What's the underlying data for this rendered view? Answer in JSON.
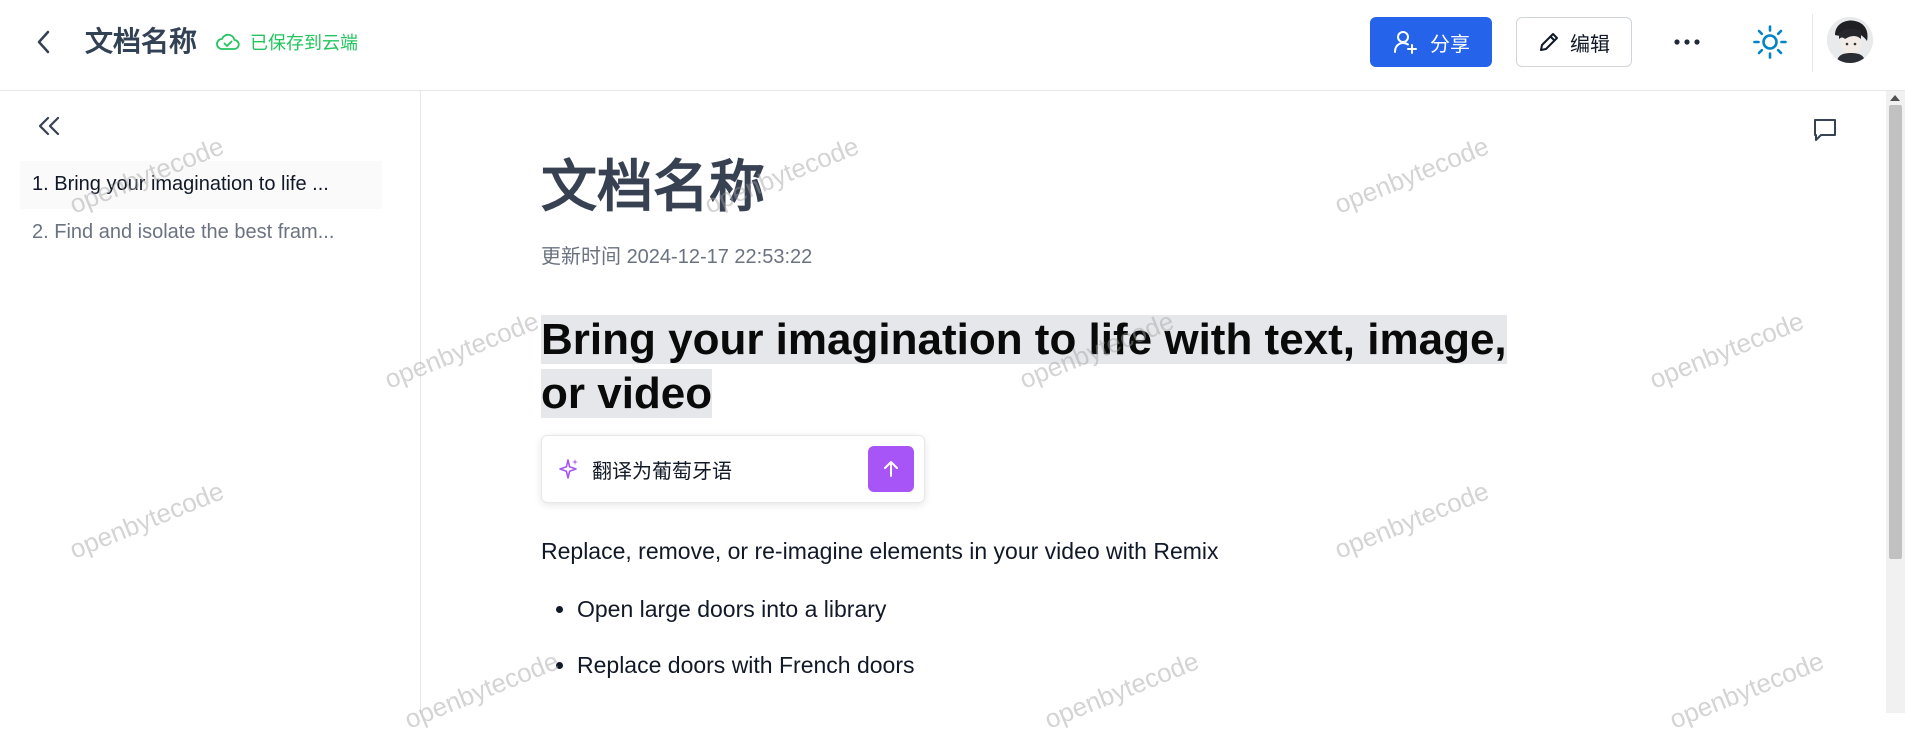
{
  "header": {
    "doc_title": "文档名称",
    "save_status": "已保存到云端",
    "share_label": "分享",
    "edit_label": "编辑"
  },
  "sidebar": {
    "toc": [
      {
        "label": "1. Bring your imagination to life ...",
        "active": true
      },
      {
        "label": "2. Find and isolate the best fram...",
        "active": false
      }
    ]
  },
  "content": {
    "title": "文档名称",
    "updated_label": "更新时间",
    "updated_time": "2024-12-17 22:53:22",
    "heading": "Bring your imagination to life with text, image, or video",
    "ai_prompt": "翻译为葡萄牙语",
    "paragraph": "Replace, remove, or re-imagine elements in your video with Remix",
    "bullets": [
      "Open large doors into a library",
      "Replace doors with French doors"
    ]
  },
  "watermark": "openbytecode",
  "colors": {
    "primary": "#2563eb",
    "saved": "#22c55e",
    "ai_send": "#a855f7",
    "theme_icon": "#0284c7"
  },
  "icons": [
    "chevron-left-icon",
    "cloud-check-icon",
    "share-user-icon",
    "pencil-icon",
    "more-horizontal-icon",
    "sun-icon",
    "double-chevron-left-icon",
    "comment-icon",
    "sparkle-icon",
    "arrow-up-icon"
  ]
}
